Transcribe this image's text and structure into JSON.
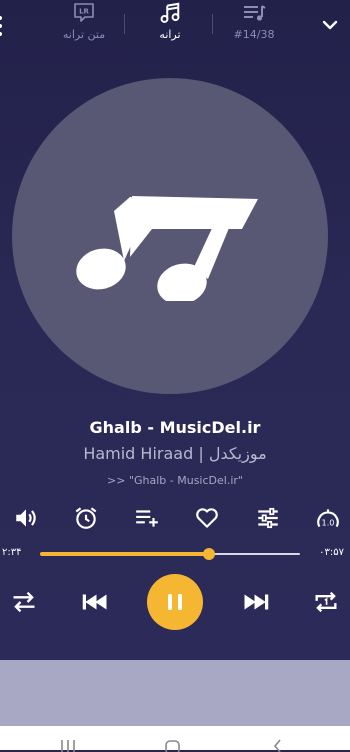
{
  "header": {
    "lyrics_label": "متن ترانه",
    "lyrics_badge": "LR",
    "song_label": "ترانه",
    "queue_label": "#14/38"
  },
  "track": {
    "title": "Ghalb - MusicDel.ir",
    "artist": "Hamid Hiraad | موزیکدل",
    "source": ">> \"Ghalb - MusicDel.ir\""
  },
  "actions": {
    "speed_label": "1.0"
  },
  "progress": {
    "elapsed": "۰۳:۵۷",
    "remaining": "۲:۳۴",
    "fraction": 0.65
  },
  "colors": {
    "accent": "#f5b731",
    "background": "#2a2854",
    "art_disc": "#585874"
  },
  "icons": [
    "menu-icon",
    "lyrics-icon",
    "music-note-icon",
    "queue-icon",
    "chevron-down-icon",
    "volume-icon",
    "alarm-icon",
    "playlist-add-icon",
    "heart-icon",
    "equalizer-icon",
    "speed-icon",
    "repeat-icon",
    "previous-icon",
    "pause-icon",
    "next-icon",
    "repeat-one-icon",
    "recents-icon",
    "home-icon",
    "back-icon"
  ]
}
